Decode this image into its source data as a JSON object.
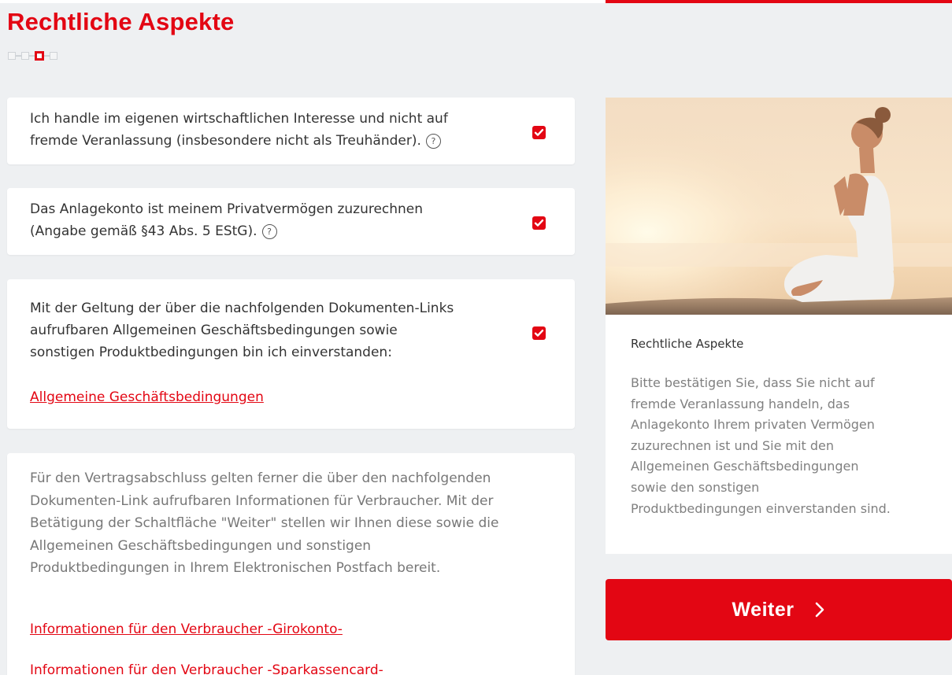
{
  "page": {
    "title": "Rechtliche Aspekte",
    "stepper": {
      "total_steps": 4,
      "current_step": 3
    }
  },
  "checks": [
    {
      "text_lines": [
        "Ich handle im eigenen wirtschaftlichen Interesse und nicht auf",
        "fremde Veranlassung (insbesondere nicht als Treuhänder)."
      ],
      "checked": true,
      "help_icon": "question-circle-icon"
    },
    {
      "text_lines": [
        "Das Anlagekonto ist meinem Privatvermögen zuzurechnen",
        "(Angabe gemäß §43 Abs. 5 EStG)."
      ],
      "checked": true,
      "help_icon": "question-circle-icon"
    },
    {
      "text_lines": [
        "Mit der Geltung der über die nachfolgenden Dokumenten-Links",
        "aufrufbaren Allgemeinen Geschäftsbedingungen sowie",
        "sonstigen Produktbedingungen bin ich einverstanden:"
      ],
      "checked": true,
      "link": "Allgemeine Geschäftsbedingungen"
    }
  ],
  "info": {
    "text_lines": [
      "Für den Vertragsabschluss gelten ferner die über den nachfolgenden",
      "Dokumenten-Link aufrufbaren Informationen für Verbraucher. Mit der",
      "Betätigung der Schaltfläche \"Weiter\" stellen wir Ihnen diese sowie die",
      "Allgemeinen Geschäftsbedingungen und sonstigen",
      "Produktbedingungen in Ihrem Elektronischen Postfach bereit."
    ],
    "links": [
      "Informationen für den Verbraucher -Girokonto-",
      "Informationen für den Verbraucher -Sparkassencard-"
    ]
  },
  "sidebar": {
    "image": "meditation-yoga-photo",
    "title": "Rechtliche Aspekte",
    "body_lines": [
      "Bitte bestätigen Sie, dass Sie nicht auf",
      "fremde Veranlassung handeln, das",
      "Anlagekonto Ihrem privaten Vermögen",
      "zuzurechnen ist und Sie mit den",
      "Allgemeinen Geschäftsbedingungen",
      "sowie den sonstigen",
      "Produktbedingungen einverstanden sind."
    ]
  },
  "actions": {
    "next_label": "Weiter",
    "next_icon": "chevron-right-icon"
  },
  "colors": {
    "accent": "#e30613",
    "background": "#eef0f2",
    "card": "#ffffff",
    "text": "#333333",
    "muted_text": "#777777"
  }
}
